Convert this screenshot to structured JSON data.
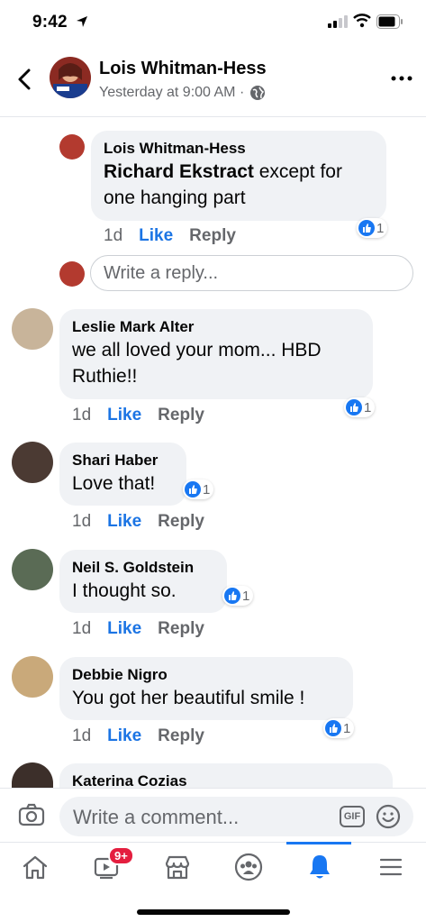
{
  "status_bar": {
    "time": "9:42"
  },
  "header": {
    "name": "Lois Whitman-Hess",
    "meta": "Yesterday at 9:00 AM ·"
  },
  "comments": [
    {
      "name": "Lois Whitman-Hess",
      "mention": "Richard Ekstract",
      "text": " except for one hanging part",
      "age": "1d",
      "like": "Like",
      "reply": "Reply",
      "reactions": "1",
      "avatar_color": "#b33a2f"
    },
    {
      "name": "Leslie Mark Alter",
      "text": "we all loved your mom...  HBD Ruthie!!",
      "age": "1d",
      "like": "Like",
      "reply": "Reply",
      "reactions": "1",
      "avatar_color": "#c8b49a"
    },
    {
      "name": "Shari Haber",
      "text": "Love that!",
      "age": "1d",
      "like": "Like",
      "reply": "Reply",
      "reactions": "1",
      "avatar_color": "#4b3a33"
    },
    {
      "name": "Neil S. Goldstein",
      "text": "I thought so.",
      "age": "1d",
      "like": "Like",
      "reply": "Reply",
      "reactions": "1",
      "avatar_color": "#5a6b55"
    },
    {
      "name": "Debbie Nigro",
      "text": "You got her beautiful smile !",
      "age": "1d",
      "like": "Like",
      "reply": "Reply",
      "reactions": "1",
      "avatar_color": "#c9a97a"
    },
    {
      "name": "Katerina Cozias",
      "avatar_color": "#3c2f2a"
    }
  ],
  "reply_input": {
    "placeholder": "Write a reply..."
  },
  "comment_bar": {
    "placeholder": "Write a comment...",
    "gif_label": "GIF"
  },
  "tab_bar": {
    "video_badge": "9+",
    "tabs": [
      "home-icon",
      "video-icon",
      "marketplace-icon",
      "groups-icon",
      "notifications-icon",
      "menu-icon"
    ],
    "active_color": "#1877f2"
  }
}
